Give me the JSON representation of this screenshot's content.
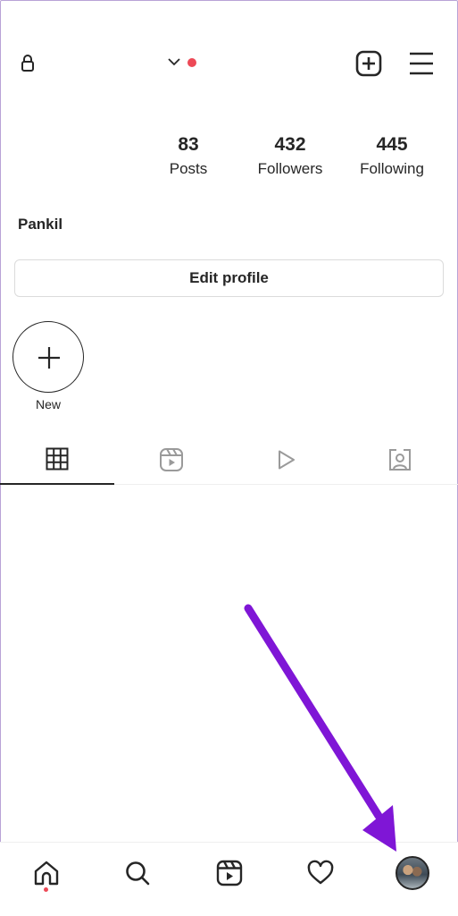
{
  "topbar": {
    "lock_icon": "lock-icon",
    "dropdown_icon": "chevron-down-icon",
    "notification_dot_color": "#ed4956",
    "create_icon": "plus-square-icon",
    "menu_icon": "hamburger-menu-icon"
  },
  "stats": {
    "posts": {
      "count": "83",
      "label": "Posts"
    },
    "followers": {
      "count": "432",
      "label": "Followers"
    },
    "following": {
      "count": "445",
      "label": "Following"
    }
  },
  "profile": {
    "name": "Pankil",
    "edit_button_label": "Edit profile"
  },
  "highlights": {
    "new_label": "New",
    "new_icon": "plus-icon"
  },
  "tabs": [
    {
      "icon": "grid-icon",
      "selected": true
    },
    {
      "icon": "reels-icon",
      "selected": false
    },
    {
      "icon": "play-icon",
      "selected": false
    },
    {
      "icon": "tagged-person-icon",
      "selected": false
    }
  ],
  "bottom_nav": [
    {
      "icon": "home-icon",
      "has_dot": true
    },
    {
      "icon": "search-icon"
    },
    {
      "icon": "reels-icon"
    },
    {
      "icon": "heart-icon"
    },
    {
      "icon": "profile-avatar"
    }
  ],
  "annotation": {
    "arrow_color": "#7f16d6"
  }
}
